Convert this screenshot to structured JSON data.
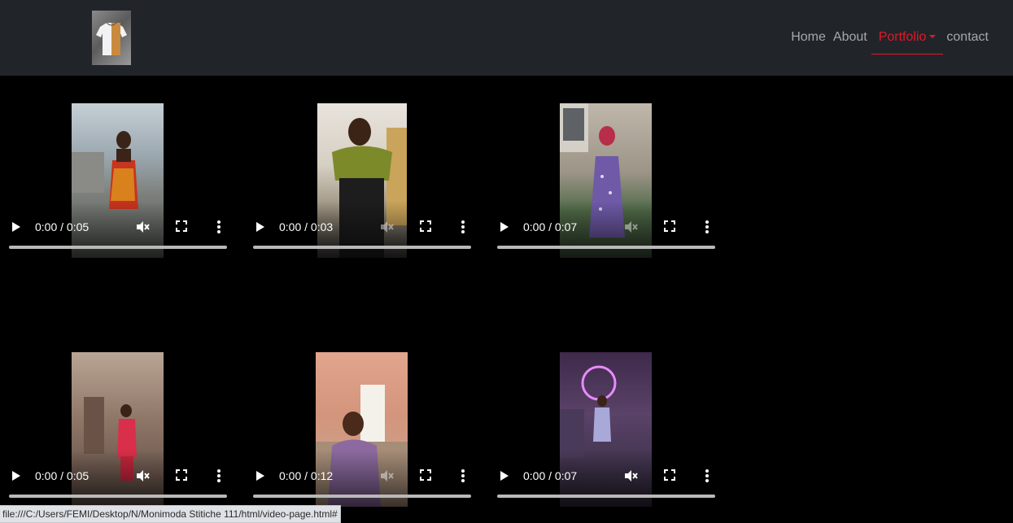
{
  "nav": {
    "items": [
      {
        "label": "Home"
      },
      {
        "label": "About"
      },
      {
        "label": "Portfolio"
      },
      {
        "label": "contact"
      }
    ],
    "active_color": "#e3182b"
  },
  "videos": [
    {
      "time": "0:00 / 0:05",
      "muted": true
    },
    {
      "time": "0:00 / 0:03",
      "muted": true
    },
    {
      "time": "0:00 / 0:07",
      "muted": true
    },
    {
      "time": "0:00 / 0:05",
      "muted": true
    },
    {
      "time": "0:00 / 0:12",
      "muted": true
    },
    {
      "time": "0:00 / 0:07",
      "muted": true
    }
  ],
  "status_bar": {
    "url": "file:///C:/Users/FEMI/Desktop/N/Monimoda Stitiche 111/html/video-page.html#"
  }
}
